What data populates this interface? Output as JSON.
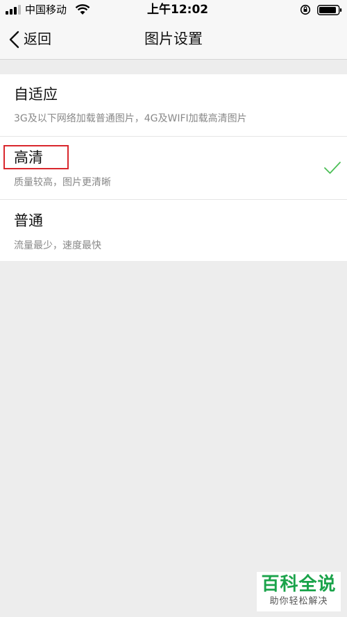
{
  "status_bar": {
    "carrier": "中国移动",
    "time": "上午12:02"
  },
  "nav": {
    "back_label": "返回",
    "title": "图片设置"
  },
  "options": [
    {
      "title": "自适应",
      "subtitle": "3G及以下网络加载普通图片，4G及WIFI加载高清图片",
      "selected": false
    },
    {
      "title": "高清",
      "subtitle": "质量较高，图片更清晰",
      "selected": true
    },
    {
      "title": "普通",
      "subtitle": "流量最少，速度最快",
      "selected": false
    }
  ],
  "annotation": {
    "highlight_color": "#d9262c"
  },
  "watermark": {
    "title": "百科全说",
    "subtitle": "助你轻松解决",
    "color": "#1aa34a"
  },
  "colors": {
    "check": "#4cbf57",
    "background": "#ededed"
  }
}
